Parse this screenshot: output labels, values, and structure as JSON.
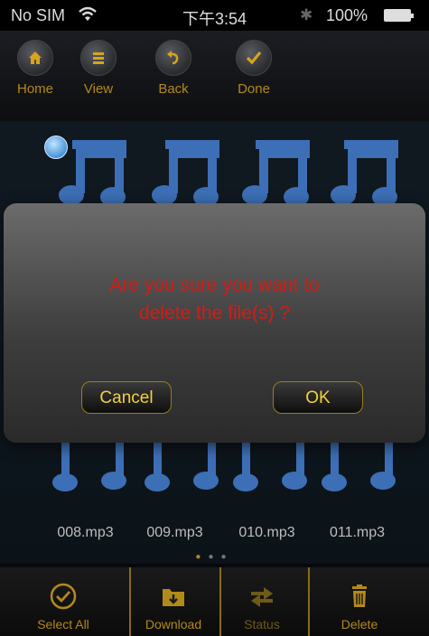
{
  "status_bar": {
    "carrier": "No SIM",
    "time": "下午3:54",
    "battery_percent": "100%",
    "battery_level": 1.0
  },
  "toolbar": {
    "home_label": "Home",
    "view_label": "View",
    "back_label": "Back",
    "done_label": "Done"
  },
  "grid": {
    "visible_filenames": [
      "008.mp3",
      "009.mp3",
      "010.mp3",
      "011.mp3"
    ],
    "selected_count": 1,
    "page_indicator": {
      "pages": 3,
      "active": 1
    }
  },
  "dialog": {
    "message_line1": "Are you sure you want to",
    "message_line2": "delete the file(s) ?",
    "cancel_label": "Cancel",
    "ok_label": "OK"
  },
  "bottom_bar": {
    "select_all_label": "Select All",
    "download_label": "Download",
    "status_label": "Status",
    "delete_label": "Delete"
  },
  "colors": {
    "accent_gold": "#b28a1a",
    "message_red": "#d61b14",
    "note_blue": "#3d6fb6"
  },
  "icons": [
    "wifi-icon",
    "bluetooth-icon",
    "battery-icon",
    "home-icon",
    "view-list-icon",
    "back-arrow-icon",
    "done-check-icon",
    "music-note-icon",
    "select-all-check-icon",
    "download-folder-icon",
    "status-arrows-icon",
    "delete-trash-icon"
  ]
}
